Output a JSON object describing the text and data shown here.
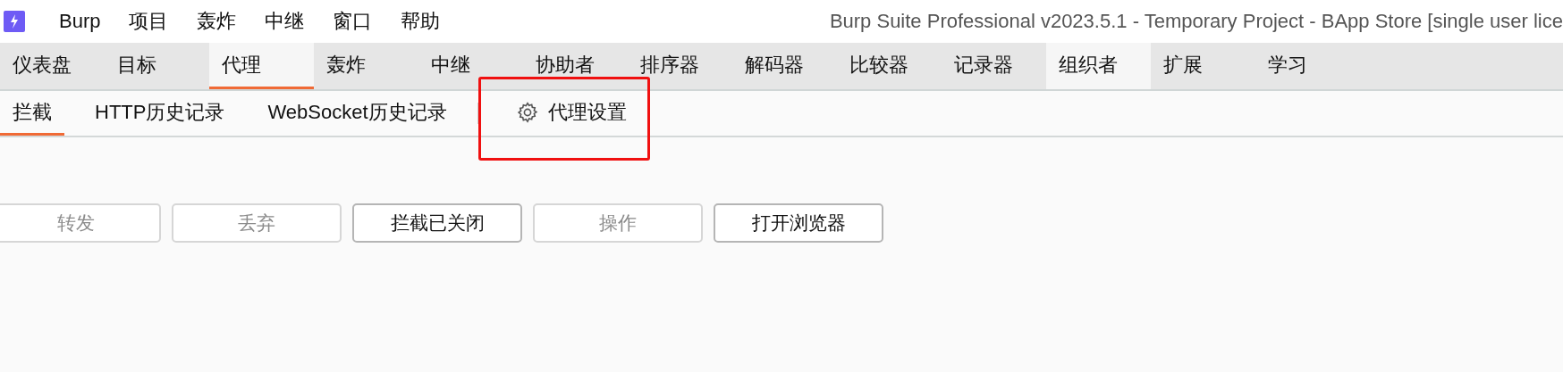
{
  "menu_bar": {
    "items": [
      "Burp",
      "项目",
      "轰炸",
      "中继",
      "窗口",
      "帮助"
    ]
  },
  "window": {
    "title": "Burp Suite Professional v2023.5.1 - Temporary Project - BApp Store [single user lice"
  },
  "tabs": [
    {
      "label": "仪表盘",
      "selected": false,
      "hovered": false
    },
    {
      "label": "目标",
      "selected": false,
      "hovered": false
    },
    {
      "label": "代理",
      "selected": true,
      "hovered": false
    },
    {
      "label": "轰炸",
      "selected": false,
      "hovered": false
    },
    {
      "label": "中继",
      "selected": false,
      "hovered": false
    },
    {
      "label": "协助者",
      "selected": false,
      "hovered": false
    },
    {
      "label": "排序器",
      "selected": false,
      "hovered": false
    },
    {
      "label": "解码器",
      "selected": false,
      "hovered": false
    },
    {
      "label": "比较器",
      "selected": false,
      "hovered": false
    },
    {
      "label": "记录器",
      "selected": false,
      "hovered": false
    },
    {
      "label": "组织者",
      "selected": false,
      "hovered": true
    },
    {
      "label": "扩展",
      "selected": false,
      "hovered": false
    },
    {
      "label": "学习",
      "selected": false,
      "hovered": false
    }
  ],
  "subtabs": [
    {
      "label": "拦截",
      "selected": true,
      "kind": "tab"
    },
    {
      "label": "HTTP历史记录",
      "selected": false,
      "kind": "tab"
    },
    {
      "label": "WebSocket历史记录",
      "selected": false,
      "kind": "tab"
    },
    {
      "label": "代理设置",
      "selected": false,
      "kind": "settings",
      "highlighted": true
    }
  ],
  "buttons": [
    {
      "label": "转发",
      "disabled": true
    },
    {
      "label": "丢弃",
      "disabled": true
    },
    {
      "label": "拦截已关闭",
      "disabled": false
    },
    {
      "label": "操作",
      "disabled": true
    },
    {
      "label": "打开浏览器",
      "disabled": false
    }
  ]
}
